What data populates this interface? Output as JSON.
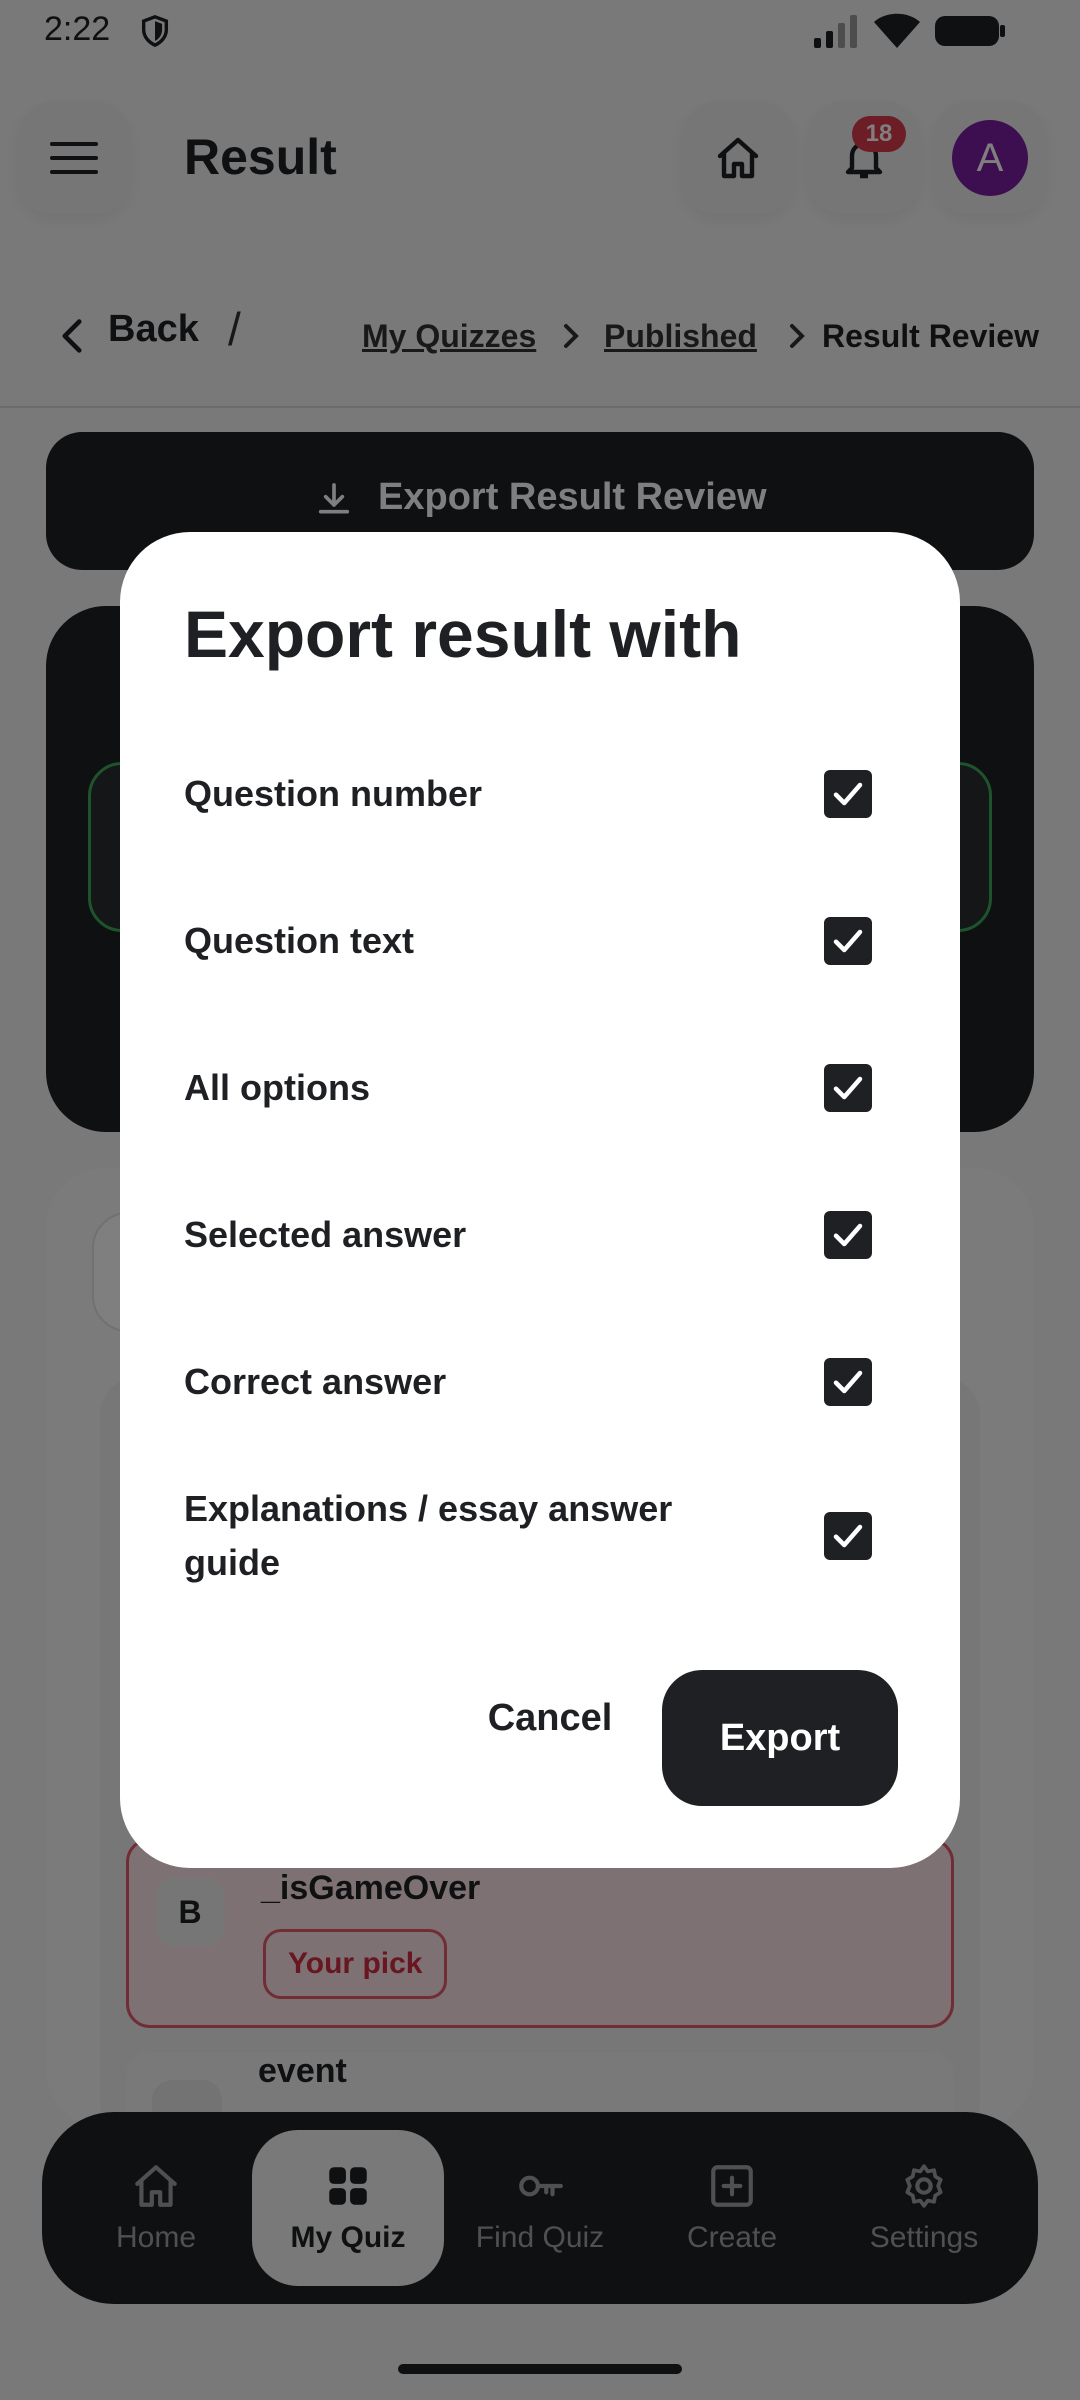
{
  "status_bar": {
    "time": "2:22"
  },
  "app_bar": {
    "title": "Result",
    "notification_count": "18",
    "avatar_initial": "A"
  },
  "breadcrumb": {
    "back_label": "Back",
    "separator": "/",
    "items": [
      "My Quizzes",
      "Published",
      "Result Review"
    ]
  },
  "background": {
    "export_button_label": "Export Result Review",
    "option_b": {
      "letter": "B",
      "text": "_isGameOver",
      "tag": "Your pick"
    },
    "option_c": {
      "text": "event"
    }
  },
  "dialog": {
    "title": "Export result with",
    "options": [
      {
        "label": "Question number",
        "checked": true
      },
      {
        "label": "Question text",
        "checked": true
      },
      {
        "label": "All options",
        "checked": true
      },
      {
        "label": "Selected answer",
        "checked": true
      },
      {
        "label": "Correct answer",
        "checked": true
      },
      {
        "label": "Explanations / essay answer guide",
        "checked": true
      }
    ],
    "cancel_label": "Cancel",
    "export_label": "Export"
  },
  "bottom_nav": {
    "items": [
      {
        "label": "Home",
        "icon": "home-icon",
        "active": false
      },
      {
        "label": "My Quiz",
        "icon": "grid-icon",
        "active": true
      },
      {
        "label": "Find Quiz",
        "icon": "key-icon",
        "active": false
      },
      {
        "label": "Create",
        "icon": "plus-square-icon",
        "active": false
      },
      {
        "label": "Settings",
        "icon": "gear-icon",
        "active": false
      }
    ]
  },
  "colors": {
    "primary_dark": "#1f2023",
    "avatar": "#7b1fa2",
    "badge": "#d83a4a",
    "wrong_pick": "#e35a6a",
    "correct_outline": "#3aa85a"
  }
}
